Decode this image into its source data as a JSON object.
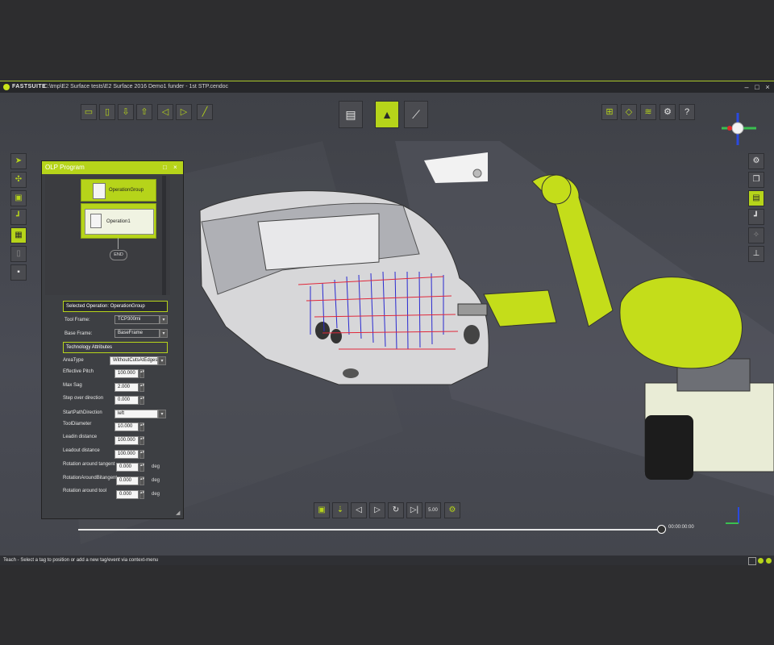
{
  "window": {
    "brand": "FASTSUITE",
    "path": "C:\\tmp\\E2 Surface tests\\E2 Surface 2016 Demo1 funder - 1st STP.cendoc",
    "minimize": "–",
    "maximize": "□",
    "close": "×"
  },
  "panel": {
    "title": "OLP Program",
    "tree": {
      "group_label": "OperationGroup",
      "op_label": "Operation1",
      "end_label": "END"
    },
    "selected_operation": "Selected Operation: OperationGroup",
    "tool_frame_label": "Tool Frame:",
    "tool_frame_value": "TCP300mi",
    "base_frame_label": "Base Frame:",
    "base_frame_value": "BaseFrame",
    "tech_attrs": "Technology Attributes",
    "fields": [
      {
        "label": "AreaType",
        "value": "WithoutCutsAtEdges",
        "type": "select"
      },
      {
        "label": "Effective Pitch",
        "value": "100.000",
        "type": "spin"
      },
      {
        "label": "Max Sag",
        "value": "2.000",
        "type": "spin"
      },
      {
        "label": "Step over direction",
        "value": "0.000",
        "type": "spin"
      },
      {
        "label": "StartPathDirection",
        "value": "left",
        "type": "select"
      },
      {
        "label": "ToolDiameter",
        "value": "10.000",
        "type": "spin"
      },
      {
        "label": "Leadin distance",
        "value": "100.000",
        "type": "spin"
      },
      {
        "label": "Leadout distance",
        "value": "100.000",
        "type": "spin"
      },
      {
        "label": "Rotation around tangent",
        "value": "0.000",
        "type": "spin",
        "unit": "deg"
      },
      {
        "label": "RotationAroundBitangent",
        "value": "0.000",
        "type": "spin",
        "unit": "deg"
      },
      {
        "label": "Rotation around tool",
        "value": "0.000",
        "type": "spin",
        "unit": "deg"
      }
    ]
  },
  "playback": {
    "speed": "5.00",
    "time": "00:00:00:00"
  },
  "status": {
    "text": "Teach - Select a tag to position or add a new tag/event via context-menu"
  }
}
